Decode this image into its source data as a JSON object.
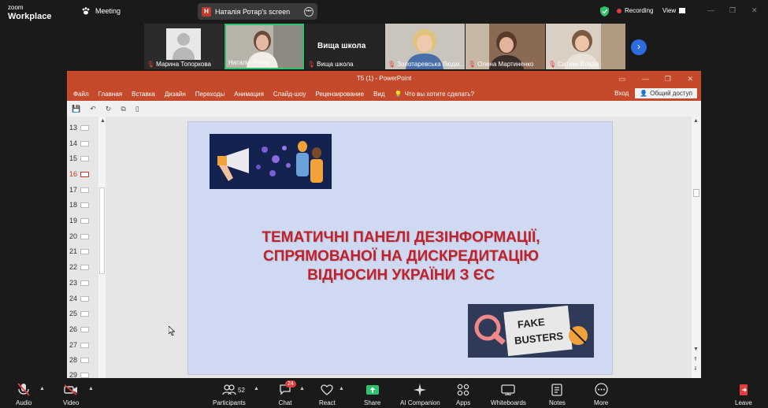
{
  "topbar": {
    "logo_line1": "zoom",
    "logo_line2": "Workplace",
    "meeting_label": "Meeting",
    "share_badge": "H",
    "share_label": "Наталія Ротар's screen",
    "recording_label": "Recording",
    "view_label": "View",
    "win_minimize": "—",
    "win_restore": "❐",
    "win_close": "✕"
  },
  "participants_strip": [
    {
      "name": "Марина Топоркова",
      "muted": true,
      "type": "avatar"
    },
    {
      "name": "Наталія Ротар",
      "muted": false,
      "type": "video",
      "active": true
    },
    {
      "name": "Вища школа",
      "muted": true,
      "type": "text",
      "display_text": "Вища школа"
    },
    {
      "name": "Золотаревська Людм...",
      "muted": true,
      "type": "video"
    },
    {
      "name": "Олена Мартиненко",
      "muted": true,
      "type": "video"
    },
    {
      "name": "Ситник Влада",
      "muted": true,
      "type": "video"
    }
  ],
  "ppt": {
    "window_title": "Т5 (1) - PowerPoint",
    "tabs": [
      "Файл",
      "Главная",
      "Вставка",
      "Дизайн",
      "Переходы",
      "Анимация",
      "Слайд-шоу",
      "Рецензирование",
      "Вид"
    ],
    "tell_me": "Что вы хотите сделать?",
    "signin": "Вход",
    "share_button": "Общий доступ",
    "slide_numbers": [
      "13",
      "14",
      "15",
      "16",
      "17",
      "18",
      "19",
      "20",
      "21",
      "22",
      "23",
      "24",
      "25",
      "26",
      "27",
      "28",
      "29"
    ],
    "current_slide": "16",
    "slide_title_lines": [
      "ТЕМАТИЧНІ ПАНЕЛІ ДЕЗІНФОРМАЦІЇ,",
      "СПРЯМОВАНОЇ НА ДИСКРЕДИТАЦІЮ",
      "ВІДНОСИН УКРАЇНИ З ЄС"
    ],
    "fake_busters_text": [
      "FAKE",
      "BUSTERS"
    ]
  },
  "bottombar": {
    "audio": "Audio",
    "video": "Video",
    "participants": "Participants",
    "participants_count": "52",
    "chat": "Chat",
    "chat_badge": "24",
    "react": "React",
    "share": "Share",
    "ai_companion": "AI Companion",
    "apps": "Apps",
    "whiteboards": "Whiteboards",
    "notes": "Notes",
    "more": "More",
    "leave": "Leave"
  },
  "colors": {
    "ppt_accent": "#c54a2b",
    "slide_bg": "#cfdaf2",
    "slide_title": "#c0212b",
    "active_speaker": "#2dc26b",
    "recording": "#e03d3d"
  }
}
